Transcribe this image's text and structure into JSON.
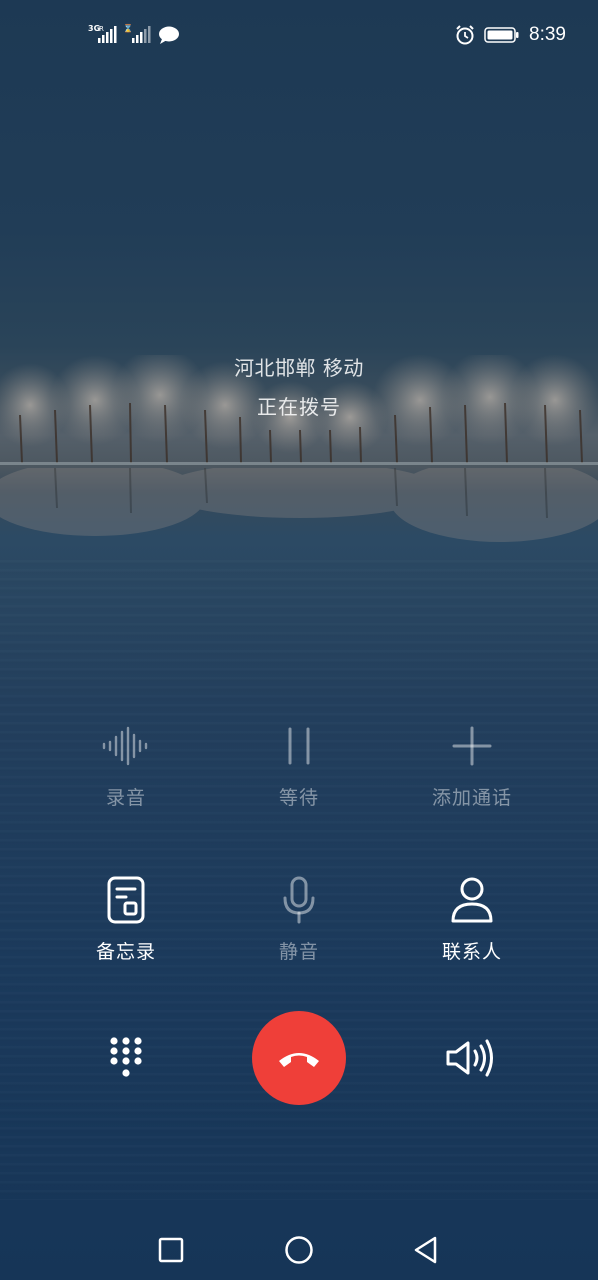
{
  "status_bar": {
    "network_type": "3G",
    "time": "8:39",
    "icons": [
      "signal-bars-icon",
      "signal-bars-2-icon",
      "message-bubble-icon",
      "alarm-icon",
      "battery-icon"
    ]
  },
  "caller": {
    "location": "河北邯郸 移动",
    "status": "正在拨号"
  },
  "controls": {
    "record": {
      "label": "录音",
      "icon": "waveform-icon",
      "enabled": false
    },
    "hold": {
      "label": "等待",
      "icon": "pause-icon",
      "enabled": false
    },
    "add_call": {
      "label": "添加通话",
      "icon": "plus-icon",
      "enabled": false
    },
    "memo": {
      "label": "备忘录",
      "icon": "memo-icon",
      "enabled": true
    },
    "mute": {
      "label": "静音",
      "icon": "microphone-icon",
      "enabled": false
    },
    "contacts": {
      "label": "联系人",
      "icon": "person-icon",
      "enabled": true
    }
  },
  "bottom": {
    "dialpad_icon": "dialpad-icon",
    "end_call_icon": "hang-up-icon",
    "end_call_color": "#ef3f39",
    "speaker_icon": "speaker-icon"
  },
  "nav": {
    "icons": [
      "recents-square-icon",
      "home-circle-icon",
      "back-triangle-icon"
    ]
  }
}
